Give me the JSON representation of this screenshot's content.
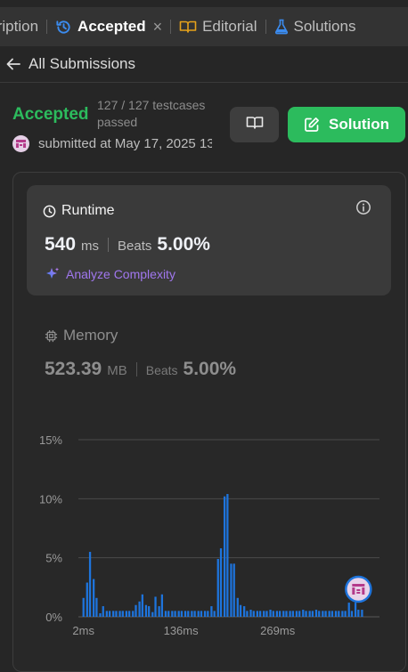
{
  "tabs": {
    "description": "Description",
    "accepted": "Accepted",
    "close": "×",
    "editorial": "Editorial",
    "solutions": "Solutions"
  },
  "back": {
    "label": "All Submissions"
  },
  "result": {
    "status": "Accepted",
    "testcases": "127 / 127 testcases passed",
    "submitted": "submitted at May 17, 2025 13"
  },
  "buttons": {
    "solution": "Solution"
  },
  "runtime": {
    "title": "Runtime",
    "value": "540",
    "unit": "ms",
    "beats_label": "Beats",
    "beats": "5.00%",
    "analyze": "Analyze Complexity"
  },
  "memory": {
    "title": "Memory",
    "value": "523.39",
    "unit": "MB",
    "beats_label": "Beats",
    "beats": "5.00%"
  },
  "colors": {
    "accepted": "#2cbb5d",
    "bar": "#1e74dc",
    "analyze": "#a077ee"
  },
  "chart_data": {
    "type": "bar",
    "title": "",
    "xlabel": "",
    "ylabel": "",
    "y_tick_labels": [
      "0%",
      "5%",
      "10%",
      "15%"
    ],
    "ylim": [
      0,
      15
    ],
    "x_tick_labels": [
      "2ms",
      "136ms",
      "269ms"
    ],
    "x_tick_positions": [
      2,
      136,
      269
    ],
    "xlim": [
      -5,
      409
    ],
    "bar_width": 4.5,
    "x": [
      2,
      7,
      11,
      16,
      20,
      25,
      29,
      34,
      38,
      43,
      47,
      52,
      56,
      61,
      65,
      70,
      74,
      79,
      83,
      88,
      92,
      97,
      101,
      106,
      110,
      115,
      119,
      124,
      128,
      133,
      137,
      142,
      146,
      151,
      155,
      160,
      164,
      169,
      173,
      178,
      182,
      187,
      191,
      196,
      200,
      205,
      209,
      214,
      218,
      223,
      227,
      232,
      236,
      241,
      245,
      250,
      254,
      259,
      263,
      268,
      272,
      277,
      281,
      286,
      290,
      295,
      299,
      304,
      308,
      313,
      317,
      322,
      326,
      331,
      335,
      340,
      344,
      349,
      353,
      358,
      362,
      367,
      371,
      376,
      380,
      385
    ],
    "values": [
      1.6,
      2.9,
      5.5,
      3.2,
      1.6,
      0.3,
      0.9,
      0.5,
      0.5,
      0.5,
      0.5,
      0.5,
      0.5,
      0.5,
      0.5,
      0.5,
      1.0,
      1.3,
      1.9,
      1.0,
      0.9,
      0.4,
      1.7,
      0.9,
      1.9,
      0.5,
      0.5,
      0.5,
      0.5,
      0.5,
      0.5,
      0.5,
      0.5,
      0.5,
      0.5,
      0.5,
      0.5,
      0.5,
      0.5,
      0.9,
      0.5,
      4.9,
      5.8,
      10.2,
      10.4,
      4.5,
      4.5,
      1.6,
      1.0,
      0.9,
      0.5,
      0.6,
      0.5,
      0.5,
      0.5,
      0.5,
      0.5,
      0.6,
      0.5,
      0.5,
      0.5,
      0.5,
      0.5,
      0.5,
      0.5,
      0.5,
      0.5,
      0.6,
      0.5,
      0.5,
      0.5,
      0.6,
      0.5,
      0.5,
      0.5,
      0.5,
      0.5,
      0.5,
      0.5,
      0.5,
      0.5,
      1.2,
      0.5,
      1.2,
      0.6,
      0.6
    ],
    "marker_x": 380,
    "grid": true
  }
}
